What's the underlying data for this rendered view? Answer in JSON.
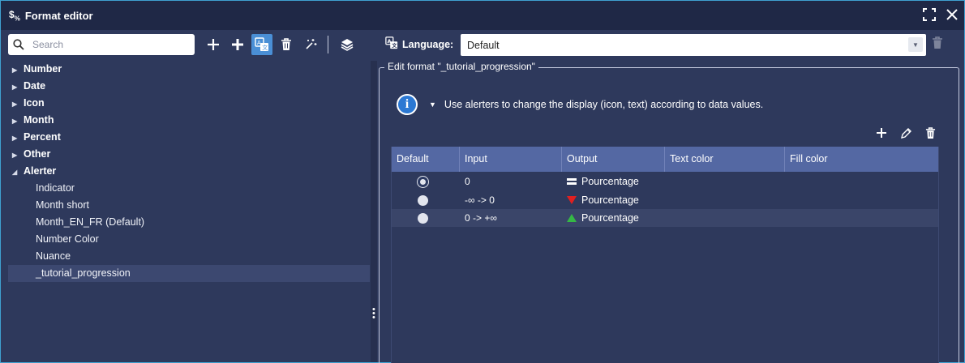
{
  "window": {
    "title": "Format editor",
    "icon_text": "$",
    "icon_sub": "%"
  },
  "search": {
    "placeholder": "Search"
  },
  "tree": {
    "folders": [
      "Number",
      "Date",
      "Icon",
      "Month",
      "Percent",
      "Other",
      "Alerter"
    ],
    "alerter_children": [
      "Indicator",
      "Month short",
      "Month_EN_FR (Default)",
      "Number Color",
      "Nuance",
      "_tutorial_progression"
    ]
  },
  "language": {
    "label": "Language:",
    "value": "Default"
  },
  "editor": {
    "legend": "Edit format \"_tutorial_progression\"",
    "info_text": "Use alerters to change the display (icon, text) according to data values."
  },
  "table": {
    "headers": [
      "Default",
      "Input",
      "Output",
      "Text color",
      "Fill color"
    ],
    "rows": [
      {
        "default": true,
        "input": "0",
        "output": "Pourcentage",
        "symbol": "equal-icon"
      },
      {
        "default": false,
        "input": "-∞ -> 0",
        "output": "Pourcentage",
        "symbol": "down-triangle-icon"
      },
      {
        "default": false,
        "input": "0 -> +∞",
        "output": "Pourcentage",
        "symbol": "up-triangle-icon"
      }
    ]
  },
  "colors": {
    "accent": "#4a8fd6",
    "header_bg": "#5468a3",
    "down": "#e02020",
    "up": "#35b845"
  }
}
